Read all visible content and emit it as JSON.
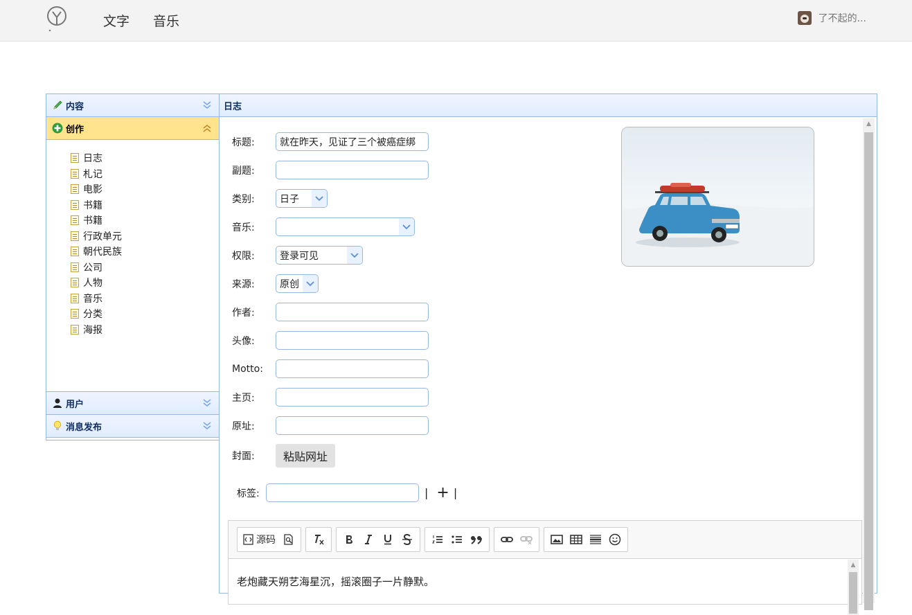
{
  "nav": {
    "links": [
      "文字",
      "音乐"
    ],
    "user_name": "了不起的..."
  },
  "sidebar": {
    "sections": [
      {
        "title": "内容",
        "icon": "pencil-icon"
      },
      {
        "title": "创作",
        "icon": "plus-icon"
      },
      {
        "title": "用户",
        "icon": "user-icon"
      },
      {
        "title": "消息发布",
        "icon": "lightbulb-icon"
      }
    ],
    "items": [
      "日志",
      "札记",
      "电影",
      "书籍",
      "书籍",
      "行政单元",
      "朝代民族",
      "公司",
      "人物",
      "音乐",
      "分类",
      "海报"
    ]
  },
  "panel": {
    "title": "日志",
    "fields": {
      "title_label": "标题:",
      "title_value": "就在昨天，见证了三个被癌症绑",
      "subtitle_label": "副题:",
      "subtitle_value": "",
      "category_label": "类别:",
      "category_value": "日子",
      "music_label": "音乐:",
      "music_value": "",
      "permission_label": "权限:",
      "permission_value": "登录可见",
      "source_label": "来源:",
      "source_value": "原创",
      "author_label": "作者:",
      "author_value": "",
      "avatar_label": "头像:",
      "avatar_value": "",
      "motto_label": "Motto:",
      "motto_value": "",
      "homepage_label": "主页:",
      "homepage_value": "",
      "origin_label": "原址:",
      "origin_value": "",
      "cover_label": "封面:",
      "paste_button": "粘贴网址",
      "tags_label": "标签:",
      "tags_value": "",
      "tag_sep_left": "|",
      "tag_add": "+",
      "tag_sep_right": "|"
    }
  },
  "editor": {
    "source_label": "源码",
    "content": "老炮藏天朔艺海星沉，摇滚圈子一片静默。"
  },
  "colors": {
    "accent_border": "#95b8e7",
    "active_section": "#ffe48d",
    "header_text": "#0e2d5f"
  }
}
